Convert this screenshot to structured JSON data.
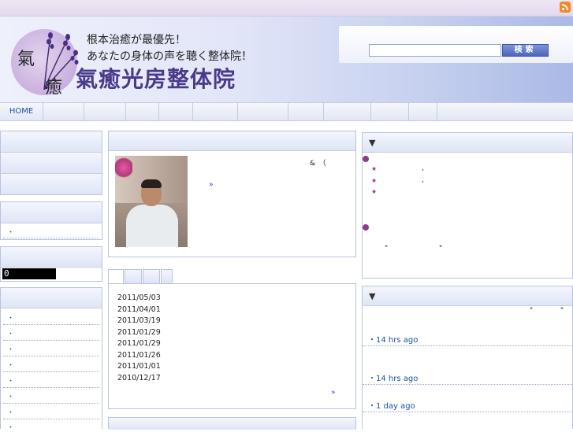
{
  "header": {
    "logo_kanji_top": "氣",
    "logo_kanji_bottom": "癒",
    "tagline_1": "根本治癒が最優先！",
    "tagline_2": "あなたの身体の声を聴く整体院！",
    "clinic_name": "氣癒光房整体院",
    "search": {
      "value": "",
      "placeholder": "",
      "button_label": "検索"
    }
  },
  "nav": {
    "items": [
      "HOME",
      "",
      "",
      "",
      "",
      "",
      "",
      "",
      "",
      "",
      "",
      ""
    ]
  },
  "left": {
    "counter_value": "0",
    "list_bullet": "・"
  },
  "center": {
    "intro_text": "&　（",
    "intro_link": "»",
    "dates": [
      "2011/05/03",
      "2011/04/01",
      "2011/03/19",
      "2011/01/29",
      "2011/01/29",
      "2011/01/26",
      "2011/01/01",
      "2010/12/17"
    ],
    "more_link": "»"
  },
  "right": {
    "panel1_marker": "▼",
    "star_glyph": "★",
    "comma": ",",
    "quote_left": "\"",
    "quote_right": "\"",
    "panel2_marker": "▼",
    "tweets": [
      {
        "time": "14 hrs ago"
      },
      {
        "time": "14 hrs ago"
      },
      {
        "time": "1 day ago"
      }
    ]
  },
  "colors": {
    "accent_purple": "#8d3a92",
    "link_blue": "#1f4fa0",
    "panel_border": "#b9c3df",
    "rss_orange": "#f08a24"
  },
  "icons": [
    "rss-icon",
    "lavender-logo-icon",
    "triangle-down-icon",
    "star-icon"
  ]
}
